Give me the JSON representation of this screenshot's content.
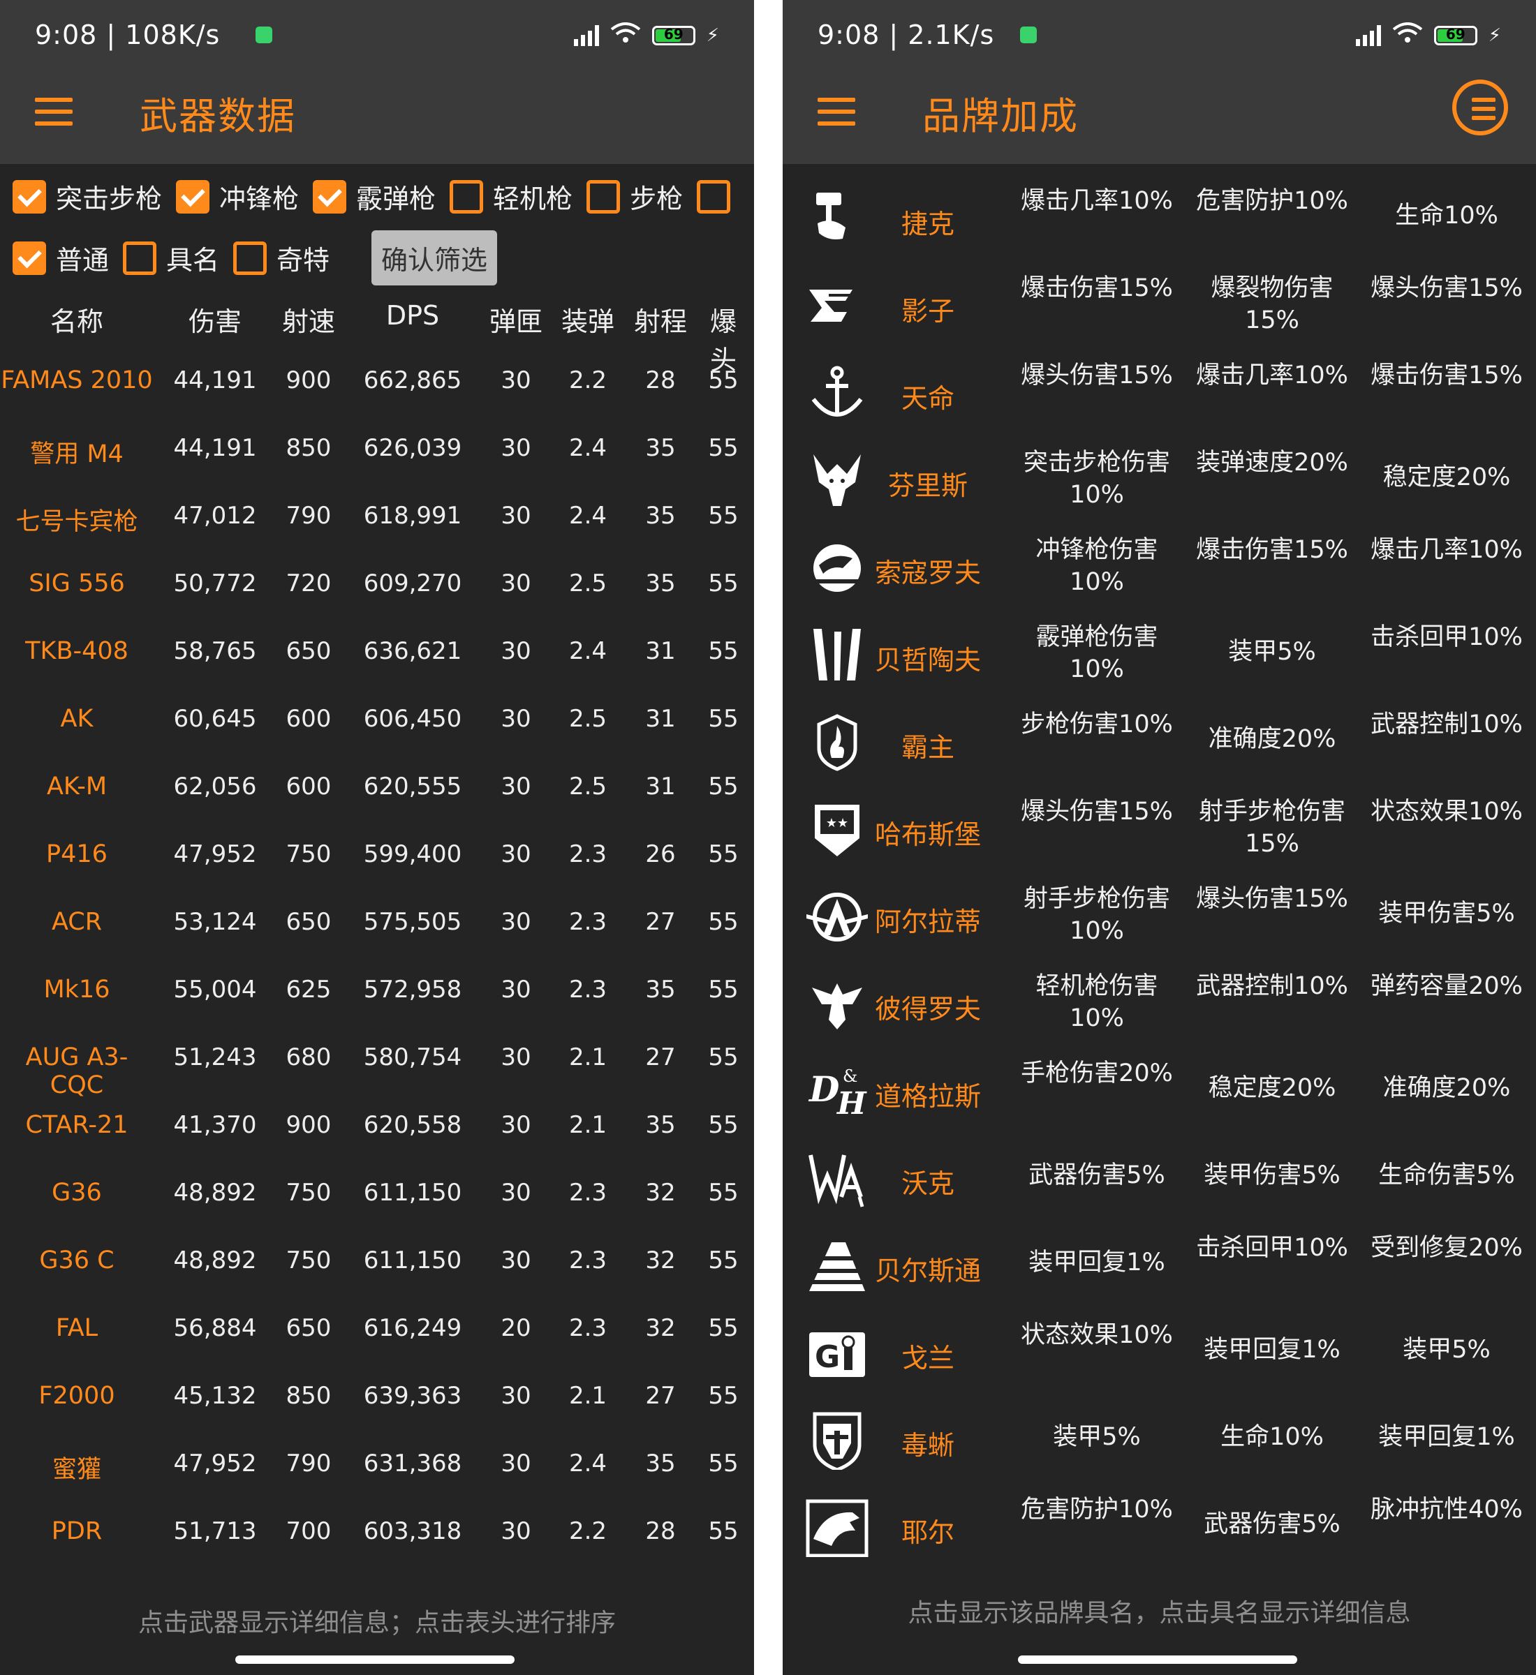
{
  "left": {
    "status": {
      "time": "9:08 | 108K/s",
      "battery": "69"
    },
    "title": "武器数据",
    "filters_row1": [
      {
        "label": "突击步枪",
        "checked": true
      },
      {
        "label": "冲锋枪",
        "checked": true
      },
      {
        "label": "霰弹枪",
        "checked": true
      },
      {
        "label": "轻机枪",
        "checked": false
      },
      {
        "label": "步枪",
        "checked": false
      }
    ],
    "filters_row2": [
      {
        "label": "普通",
        "checked": true
      },
      {
        "label": "具名",
        "checked": false
      },
      {
        "label": "奇特",
        "checked": false
      }
    ],
    "confirm_label": "确认筛选",
    "columns": [
      "名称",
      "伤害",
      "射速",
      "DPS",
      "弹匣",
      "装弹",
      "射程",
      "爆头"
    ],
    "rows": [
      [
        "FAMAS 2010",
        "44,191",
        "900",
        "662,865",
        "30",
        "2.2",
        "28",
        "55"
      ],
      [
        "警用 M4",
        "44,191",
        "850",
        "626,039",
        "30",
        "2.4",
        "35",
        "55"
      ],
      [
        "七号卡宾枪",
        "47,012",
        "790",
        "618,991",
        "30",
        "2.4",
        "35",
        "55"
      ],
      [
        "SIG 556",
        "50,772",
        "720",
        "609,270",
        "30",
        "2.5",
        "35",
        "55"
      ],
      [
        "TKB-408",
        "58,765",
        "650",
        "636,621",
        "30",
        "2.4",
        "31",
        "55"
      ],
      [
        "AK",
        "60,645",
        "600",
        "606,450",
        "30",
        "2.5",
        "31",
        "55"
      ],
      [
        "AK-M",
        "62,056",
        "600",
        "620,555",
        "30",
        "2.5",
        "31",
        "55"
      ],
      [
        "P416",
        "47,952",
        "750",
        "599,400",
        "30",
        "2.3",
        "26",
        "55"
      ],
      [
        "ACR",
        "53,124",
        "650",
        "575,505",
        "30",
        "2.3",
        "27",
        "55"
      ],
      [
        "Mk16",
        "55,004",
        "625",
        "572,958",
        "30",
        "2.3",
        "35",
        "55"
      ],
      [
        "AUG A3-CQC",
        "51,243",
        "680",
        "580,754",
        "30",
        "2.1",
        "27",
        "55"
      ],
      [
        "CTAR-21",
        "41,370",
        "900",
        "620,558",
        "30",
        "2.1",
        "35",
        "55"
      ],
      [
        "G36",
        "48,892",
        "750",
        "611,150",
        "30",
        "2.3",
        "32",
        "55"
      ],
      [
        "G36 C",
        "48,892",
        "750",
        "611,150",
        "30",
        "2.3",
        "32",
        "55"
      ],
      [
        "FAL",
        "56,884",
        "650",
        "616,249",
        "20",
        "2.3",
        "32",
        "55"
      ],
      [
        "F2000",
        "45,132",
        "850",
        "639,363",
        "30",
        "2.1",
        "27",
        "55"
      ],
      [
        "蜜獾",
        "47,952",
        "790",
        "631,368",
        "30",
        "2.4",
        "35",
        "55"
      ],
      [
        "PDR",
        "51,713",
        "700",
        "603,318",
        "30",
        "2.2",
        "28",
        "55"
      ]
    ],
    "footer": "点击武器显示详细信息；点击表头进行排序"
  },
  "right": {
    "status": {
      "time": "9:08 | 2.1K/s",
      "battery": "69"
    },
    "title": "品牌加成",
    "brands": [
      {
        "name": "捷克",
        "icon": "hand-hammer-icon",
        "b1": "爆击几率10%",
        "b2": "危害防护10%",
        "b3": "生命10%"
      },
      {
        "name": "影子",
        "icon": "shadow-logo-icon",
        "b1": "爆击伤害15%",
        "b2": "爆裂物伤害15%",
        "b3": "爆头伤害15%"
      },
      {
        "name": "天命",
        "icon": "anchor-icon",
        "b1": "爆头伤害15%",
        "b2": "爆击几率10%",
        "b3": "爆击伤害15%"
      },
      {
        "name": "芬里斯",
        "icon": "wolf-head-icon",
        "b1": "突击步枪伤害10%",
        "b2": "装弹速度20%",
        "b3": "稳定度20%"
      },
      {
        "name": "索寇罗夫",
        "icon": "eagle-badge-icon",
        "b1": "冲锋枪伤害10%",
        "b2": "爆击伤害15%",
        "b3": "爆击几率10%"
      },
      {
        "name": "贝哲陶夫",
        "icon": "blades-icon",
        "b1": "霰弹枪伤害10%",
        "b2": "装甲5%",
        "b3": "击杀回甲10%"
      },
      {
        "name": "霸主",
        "icon": "flame-shield-icon",
        "b1": "步枪伤害10%",
        "b2": "准确度20%",
        "b3": "武器控制10%"
      },
      {
        "name": "哈布斯堡",
        "icon": "star-shield-icon",
        "b1": "爆头伤害15%",
        "b2": "射手步枪伤害15%",
        "b3": "状态效果10%"
      },
      {
        "name": "阿尔拉蒂",
        "icon": "winged-a-icon",
        "b1": "射手步枪伤害10%",
        "b2": "爆头伤害15%",
        "b3": "装甲伤害5%"
      },
      {
        "name": "彼得罗夫",
        "icon": "double-eagle-icon",
        "b1": "轻机枪伤害10%",
        "b2": "武器控制10%",
        "b3": "弹药容量20%"
      },
      {
        "name": "道格拉斯",
        "icon": "dh-monogram-icon",
        "b1": "手枪伤害20%",
        "b2": "稳定度20%",
        "b3": "准确度20%"
      },
      {
        "name": "沃克",
        "icon": "wa-monogram-icon",
        "b1": "武器伤害5%",
        "b2": "装甲伤害5%",
        "b3": "生命伤害5%"
      },
      {
        "name": "贝尔斯通",
        "icon": "striped-a-icon",
        "b1": "装甲回复1%",
        "b2": "击杀回甲10%",
        "b3": "受到修复20%"
      },
      {
        "name": "戈兰",
        "icon": "gi-monogram-icon",
        "b1": "状态效果10%",
        "b2": "装甲回复1%",
        "b3": "装甲5%"
      },
      {
        "name": "毒蜥",
        "icon": "helmet-shield-icon",
        "b1": "装甲5%",
        "b2": "生命10%",
        "b3": "装甲回复1%"
      },
      {
        "name": "耶尔",
        "icon": "eagle-head-icon",
        "b1": "危害防护10%",
        "b2": "武器伤害5%",
        "b3": "脉冲抗性40%"
      }
    ],
    "footer": "点击显示该品牌具名，点击具名显示详细信息"
  },
  "colors": {
    "accent": "#ff8a1c",
    "background": "#242424",
    "toolbar": "#3a3a3a"
  }
}
